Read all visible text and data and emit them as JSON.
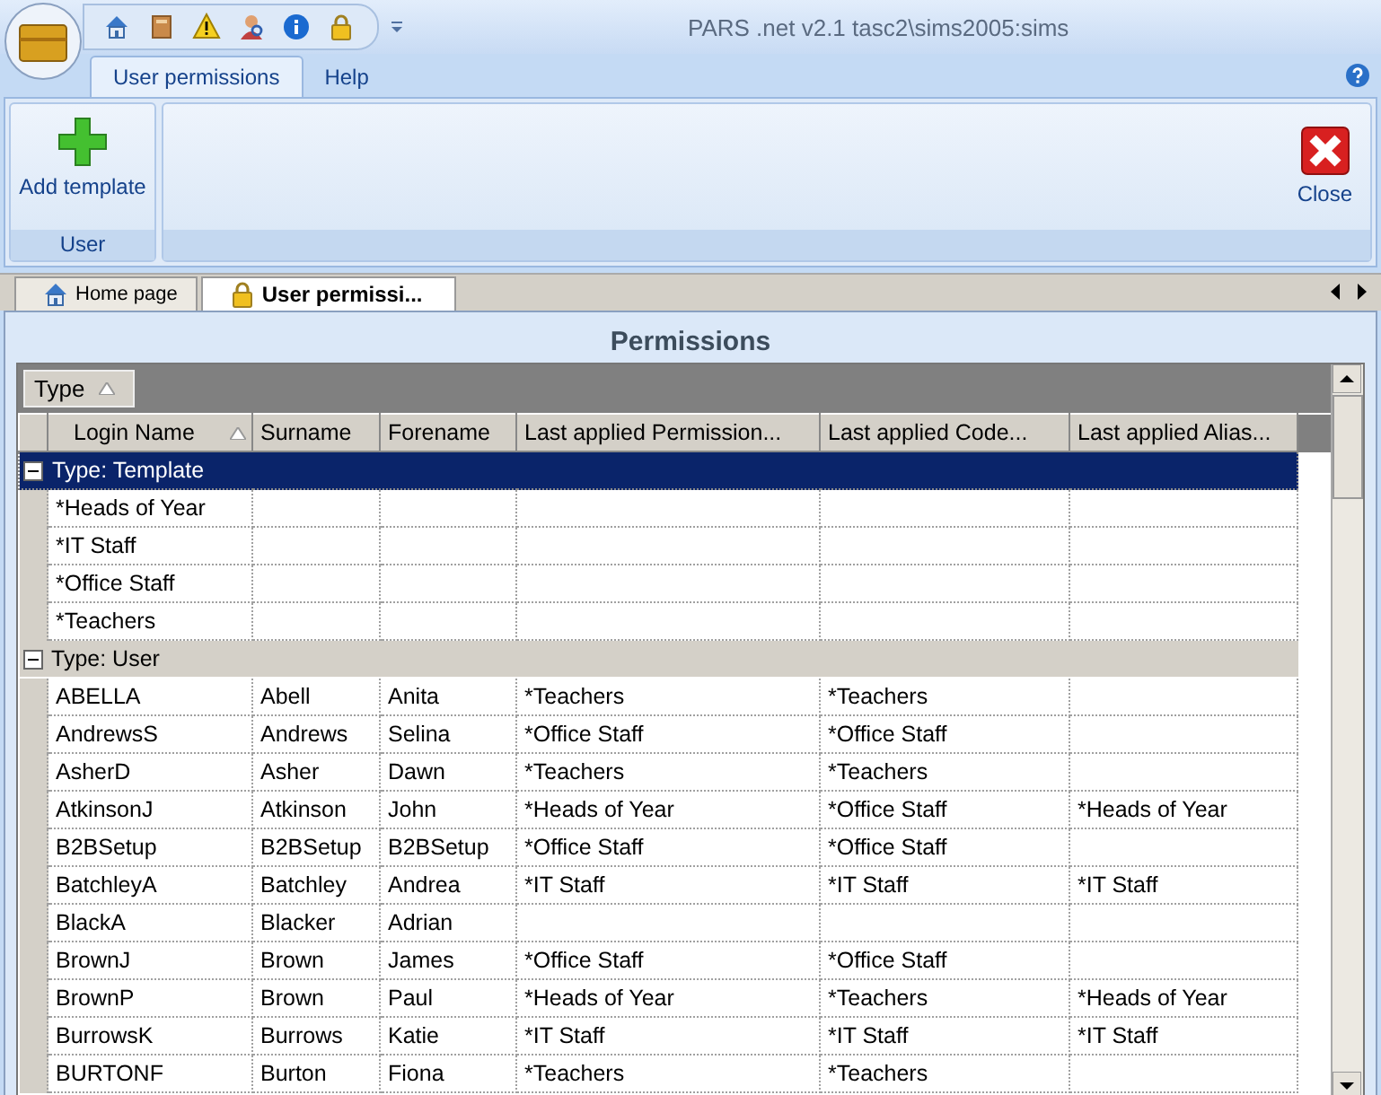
{
  "window": {
    "title": "PARS .net v2.1  tasc2\\sims2005:sims"
  },
  "ribbon": {
    "tabs": [
      {
        "label": "User permissions",
        "selected": true
      },
      {
        "label": "Help",
        "selected": false
      }
    ],
    "groups": [
      {
        "label": "User",
        "buttons": [
          {
            "label": "Add template",
            "kind": "add"
          }
        ]
      },
      {
        "buttons": [
          {
            "label": "Close",
            "kind": "close"
          }
        ]
      }
    ]
  },
  "doc_tabs": [
    {
      "label": "Home page",
      "kind": "home",
      "selected": false
    },
    {
      "label": "User permissi...",
      "kind": "lock",
      "selected": true
    }
  ],
  "panel": {
    "title": "Permissions"
  },
  "grid": {
    "group_by": [
      {
        "label": "Type"
      }
    ],
    "columns": [
      "Login Name",
      "Surname",
      "Forename",
      "Last applied Permission...",
      "Last applied Code...",
      "Last applied Alias..."
    ],
    "groups": [
      {
        "label": "Type: Template",
        "expanded": true,
        "selected": true,
        "rows": [
          [
            "*Heads of Year",
            "",
            "",
            "",
            "",
            ""
          ],
          [
            "*IT Staff",
            "",
            "",
            "",
            "",
            ""
          ],
          [
            "*Office Staff",
            "",
            "",
            "",
            "",
            ""
          ],
          [
            "*Teachers",
            "",
            "",
            "",
            "",
            ""
          ]
        ]
      },
      {
        "label": "Type: User",
        "expanded": true,
        "selected": false,
        "rows": [
          [
            "ABELLA",
            "Abell",
            "Anita",
            "*Teachers",
            "*Teachers",
            ""
          ],
          [
            "AndrewsS",
            "Andrews",
            "Selina",
            "*Office Staff",
            "*Office Staff",
            ""
          ],
          [
            "AsherD",
            "Asher",
            "Dawn",
            "*Teachers",
            "*Teachers",
            ""
          ],
          [
            "AtkinsonJ",
            "Atkinson",
            "John",
            "*Heads of Year",
            "*Office Staff",
            "*Heads of Year"
          ],
          [
            "B2BSetup",
            "B2BSetup",
            "B2BSetup",
            "*Office Staff",
            "*Office Staff",
            ""
          ],
          [
            "BatchleyA",
            "Batchley",
            "Andrea",
            "*IT Staff",
            "*IT Staff",
            "*IT Staff"
          ],
          [
            "BlackA",
            "Blacker",
            "Adrian",
            "",
            "",
            ""
          ],
          [
            "BrownJ",
            "Brown",
            "James",
            "*Office Staff",
            "*Office Staff",
            ""
          ],
          [
            "BrownP",
            "Brown",
            "Paul",
            "*Heads of Year",
            "*Teachers",
            "*Heads of Year"
          ],
          [
            "BurrowsK",
            "Burrows",
            "Katie",
            "*IT Staff",
            "*IT Staff",
            "*IT Staff"
          ],
          [
            "BURTONF",
            "Burton",
            "Fiona",
            "*Teachers",
            "*Teachers",
            ""
          ]
        ]
      }
    ]
  }
}
